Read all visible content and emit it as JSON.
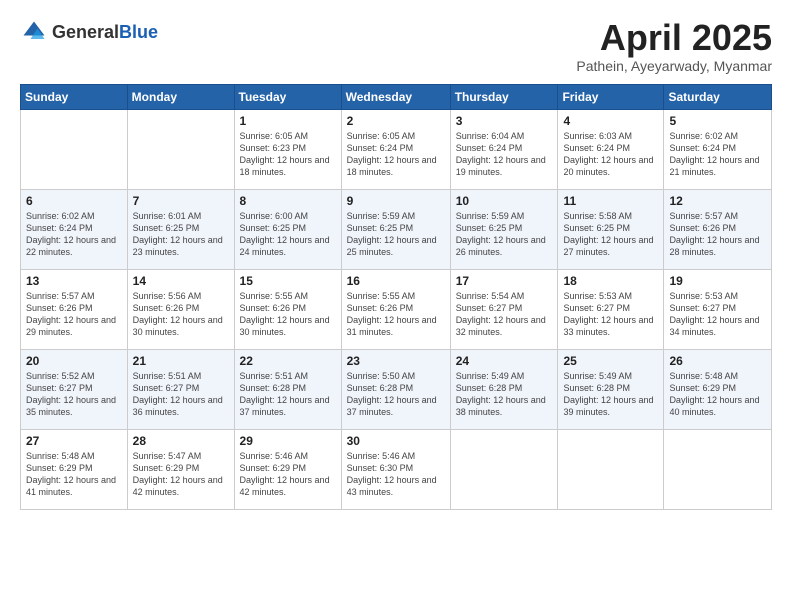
{
  "header": {
    "logo_general": "General",
    "logo_blue": "Blue",
    "title": "April 2025",
    "subtitle": "Pathein, Ayeyarwady, Myanmar"
  },
  "weekdays": [
    "Sunday",
    "Monday",
    "Tuesday",
    "Wednesday",
    "Thursday",
    "Friday",
    "Saturday"
  ],
  "weeks": [
    [
      {
        "day": "",
        "sunrise": "",
        "sunset": "",
        "daylight": ""
      },
      {
        "day": "",
        "sunrise": "",
        "sunset": "",
        "daylight": ""
      },
      {
        "day": "1",
        "sunrise": "Sunrise: 6:05 AM",
        "sunset": "Sunset: 6:23 PM",
        "daylight": "Daylight: 12 hours and 18 minutes."
      },
      {
        "day": "2",
        "sunrise": "Sunrise: 6:05 AM",
        "sunset": "Sunset: 6:24 PM",
        "daylight": "Daylight: 12 hours and 18 minutes."
      },
      {
        "day": "3",
        "sunrise": "Sunrise: 6:04 AM",
        "sunset": "Sunset: 6:24 PM",
        "daylight": "Daylight: 12 hours and 19 minutes."
      },
      {
        "day": "4",
        "sunrise": "Sunrise: 6:03 AM",
        "sunset": "Sunset: 6:24 PM",
        "daylight": "Daylight: 12 hours and 20 minutes."
      },
      {
        "day": "5",
        "sunrise": "Sunrise: 6:02 AM",
        "sunset": "Sunset: 6:24 PM",
        "daylight": "Daylight: 12 hours and 21 minutes."
      }
    ],
    [
      {
        "day": "6",
        "sunrise": "Sunrise: 6:02 AM",
        "sunset": "Sunset: 6:24 PM",
        "daylight": "Daylight: 12 hours and 22 minutes."
      },
      {
        "day": "7",
        "sunrise": "Sunrise: 6:01 AM",
        "sunset": "Sunset: 6:25 PM",
        "daylight": "Daylight: 12 hours and 23 minutes."
      },
      {
        "day": "8",
        "sunrise": "Sunrise: 6:00 AM",
        "sunset": "Sunset: 6:25 PM",
        "daylight": "Daylight: 12 hours and 24 minutes."
      },
      {
        "day": "9",
        "sunrise": "Sunrise: 5:59 AM",
        "sunset": "Sunset: 6:25 PM",
        "daylight": "Daylight: 12 hours and 25 minutes."
      },
      {
        "day": "10",
        "sunrise": "Sunrise: 5:59 AM",
        "sunset": "Sunset: 6:25 PM",
        "daylight": "Daylight: 12 hours and 26 minutes."
      },
      {
        "day": "11",
        "sunrise": "Sunrise: 5:58 AM",
        "sunset": "Sunset: 6:25 PM",
        "daylight": "Daylight: 12 hours and 27 minutes."
      },
      {
        "day": "12",
        "sunrise": "Sunrise: 5:57 AM",
        "sunset": "Sunset: 6:26 PM",
        "daylight": "Daylight: 12 hours and 28 minutes."
      }
    ],
    [
      {
        "day": "13",
        "sunrise": "Sunrise: 5:57 AM",
        "sunset": "Sunset: 6:26 PM",
        "daylight": "Daylight: 12 hours and 29 minutes."
      },
      {
        "day": "14",
        "sunrise": "Sunrise: 5:56 AM",
        "sunset": "Sunset: 6:26 PM",
        "daylight": "Daylight: 12 hours and 30 minutes."
      },
      {
        "day": "15",
        "sunrise": "Sunrise: 5:55 AM",
        "sunset": "Sunset: 6:26 PM",
        "daylight": "Daylight: 12 hours and 30 minutes."
      },
      {
        "day": "16",
        "sunrise": "Sunrise: 5:55 AM",
        "sunset": "Sunset: 6:26 PM",
        "daylight": "Daylight: 12 hours and 31 minutes."
      },
      {
        "day": "17",
        "sunrise": "Sunrise: 5:54 AM",
        "sunset": "Sunset: 6:27 PM",
        "daylight": "Daylight: 12 hours and 32 minutes."
      },
      {
        "day": "18",
        "sunrise": "Sunrise: 5:53 AM",
        "sunset": "Sunset: 6:27 PM",
        "daylight": "Daylight: 12 hours and 33 minutes."
      },
      {
        "day": "19",
        "sunrise": "Sunrise: 5:53 AM",
        "sunset": "Sunset: 6:27 PM",
        "daylight": "Daylight: 12 hours and 34 minutes."
      }
    ],
    [
      {
        "day": "20",
        "sunrise": "Sunrise: 5:52 AM",
        "sunset": "Sunset: 6:27 PM",
        "daylight": "Daylight: 12 hours and 35 minutes."
      },
      {
        "day": "21",
        "sunrise": "Sunrise: 5:51 AM",
        "sunset": "Sunset: 6:27 PM",
        "daylight": "Daylight: 12 hours and 36 minutes."
      },
      {
        "day": "22",
        "sunrise": "Sunrise: 5:51 AM",
        "sunset": "Sunset: 6:28 PM",
        "daylight": "Daylight: 12 hours and 37 minutes."
      },
      {
        "day": "23",
        "sunrise": "Sunrise: 5:50 AM",
        "sunset": "Sunset: 6:28 PM",
        "daylight": "Daylight: 12 hours and 37 minutes."
      },
      {
        "day": "24",
        "sunrise": "Sunrise: 5:49 AM",
        "sunset": "Sunset: 6:28 PM",
        "daylight": "Daylight: 12 hours and 38 minutes."
      },
      {
        "day": "25",
        "sunrise": "Sunrise: 5:49 AM",
        "sunset": "Sunset: 6:28 PM",
        "daylight": "Daylight: 12 hours and 39 minutes."
      },
      {
        "day": "26",
        "sunrise": "Sunrise: 5:48 AM",
        "sunset": "Sunset: 6:29 PM",
        "daylight": "Daylight: 12 hours and 40 minutes."
      }
    ],
    [
      {
        "day": "27",
        "sunrise": "Sunrise: 5:48 AM",
        "sunset": "Sunset: 6:29 PM",
        "daylight": "Daylight: 12 hours and 41 minutes."
      },
      {
        "day": "28",
        "sunrise": "Sunrise: 5:47 AM",
        "sunset": "Sunset: 6:29 PM",
        "daylight": "Daylight: 12 hours and 42 minutes."
      },
      {
        "day": "29",
        "sunrise": "Sunrise: 5:46 AM",
        "sunset": "Sunset: 6:29 PM",
        "daylight": "Daylight: 12 hours and 42 minutes."
      },
      {
        "day": "30",
        "sunrise": "Sunrise: 5:46 AM",
        "sunset": "Sunset: 6:30 PM",
        "daylight": "Daylight: 12 hours and 43 minutes."
      },
      {
        "day": "",
        "sunrise": "",
        "sunset": "",
        "daylight": ""
      },
      {
        "day": "",
        "sunrise": "",
        "sunset": "",
        "daylight": ""
      },
      {
        "day": "",
        "sunrise": "",
        "sunset": "",
        "daylight": ""
      }
    ]
  ]
}
